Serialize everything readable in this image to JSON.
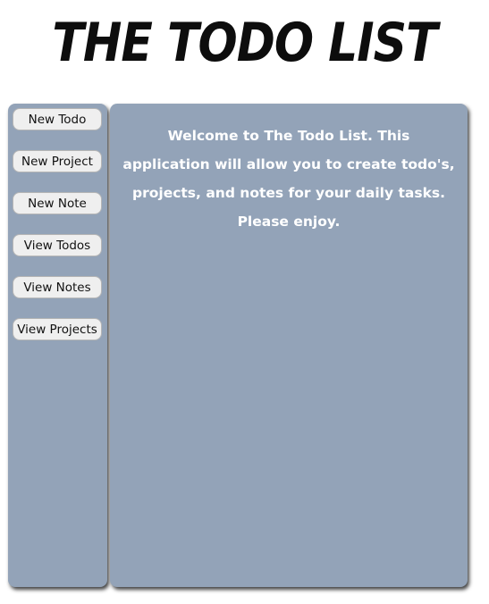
{
  "app": {
    "title": "THE TODO LIST"
  },
  "sidebar": {
    "buttons": [
      {
        "label": "New Todo"
      },
      {
        "label": "New Project"
      },
      {
        "label": "New Note"
      },
      {
        "label": "View Todos"
      },
      {
        "label": "View Notes"
      },
      {
        "label": "View Projects"
      }
    ]
  },
  "main": {
    "welcome_text": "Welcome to The Todo List. This application will allow you to create todo's, projects, and notes for your daily tasks. Please enjoy."
  },
  "colors": {
    "panel_background": "#93a3b8",
    "button_background": "#efefef",
    "title_color": "#0d0d0d",
    "welcome_text_color": "#ffffff"
  }
}
